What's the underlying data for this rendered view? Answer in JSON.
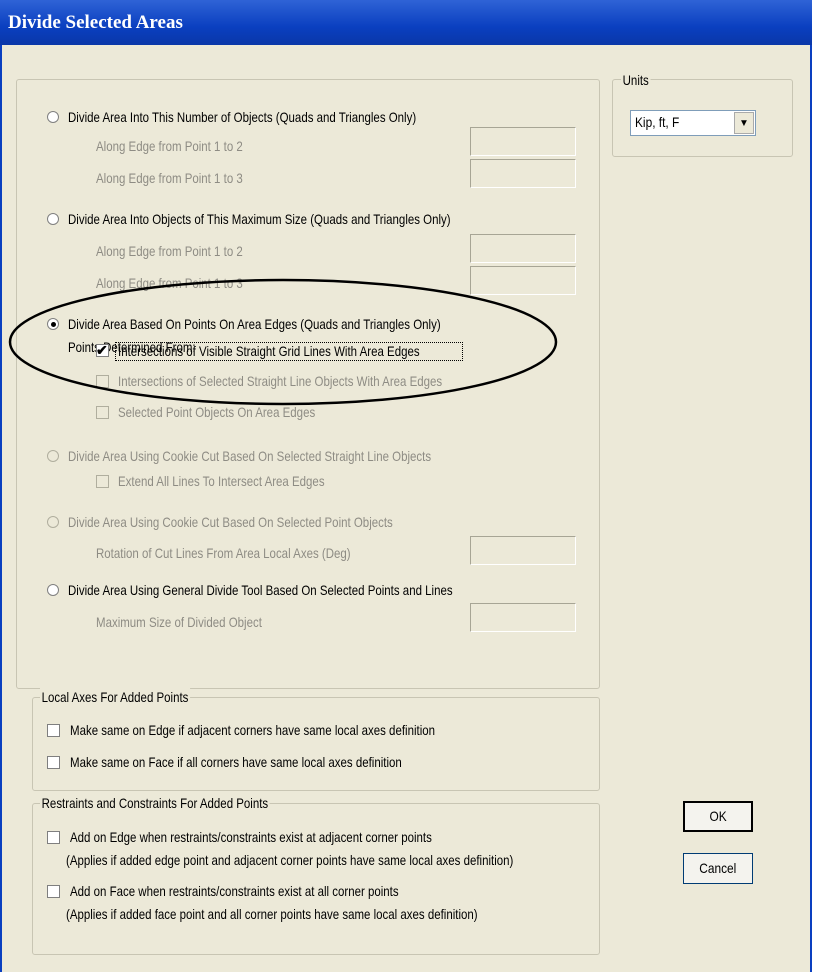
{
  "window": {
    "title": "Divide Selected Areas"
  },
  "units": {
    "label": "Units",
    "selected": "Kip, ft, F"
  },
  "options": {
    "opt1": {
      "label": "Divide Area Into This Number of Objects   (Quads and Triangles Only)",
      "edge12": "Along Edge from Point 1 to 2",
      "edge13": "Along Edge from Point 1 to 3"
    },
    "opt2": {
      "label": "Divide Area Into Objects of This Maximum Size   (Quads and Triangles Only)",
      "edge12": "Along Edge from Point 1 to 2",
      "edge13": "Along Edge from Point 1 to 3"
    },
    "opt3": {
      "label": "Divide Area Based On Points On Area Edges   (Quads and Triangles Only)",
      "points_from": "Points Determined From:",
      "cb_grid": "Intersections of Visible Straight Grid Lines With Area Edges",
      "cb_lines": "Intersections of Selected Straight Line Objects With Area Edges",
      "cb_points": "Selected Point Objects On Area Edges"
    },
    "opt4": {
      "label": "Divide Area Using Cookie Cut Based On Selected Straight Line Objects",
      "cb_extend": "Extend All Lines To Intersect Area Edges"
    },
    "opt5": {
      "label": "Divide Area Using Cookie Cut Based On Selected Point Objects",
      "rotation": "Rotation of Cut Lines From Area Local Axes (Deg)"
    },
    "opt6": {
      "label": "Divide Area Using General Divide Tool Based On Selected Points and Lines",
      "max_size": "Maximum Size of Divided Object"
    }
  },
  "local_axes": {
    "title": "Local Axes For Added Points",
    "edge": "Make same on Edge if adjacent corners have same local axes definition",
    "face": "Make same on Face if all corners have same local axes definition"
  },
  "restraints": {
    "title": "Restraints and Constraints For Added Points",
    "edge": "Add on Edge when restraints/constraints exist at adjacent corner points",
    "edge_note": "(Applies if added edge point and adjacent corner points have same local axes definition)",
    "face": "Add on Face when restraints/constraints exist at all corner points",
    "face_note": "(Applies if added face point and all corner points have same local axes definition)"
  },
  "buttons": {
    "ok": "OK",
    "cancel": "Cancel"
  },
  "state": {
    "selected_option": "opt3",
    "cb_grid_checked": true
  }
}
